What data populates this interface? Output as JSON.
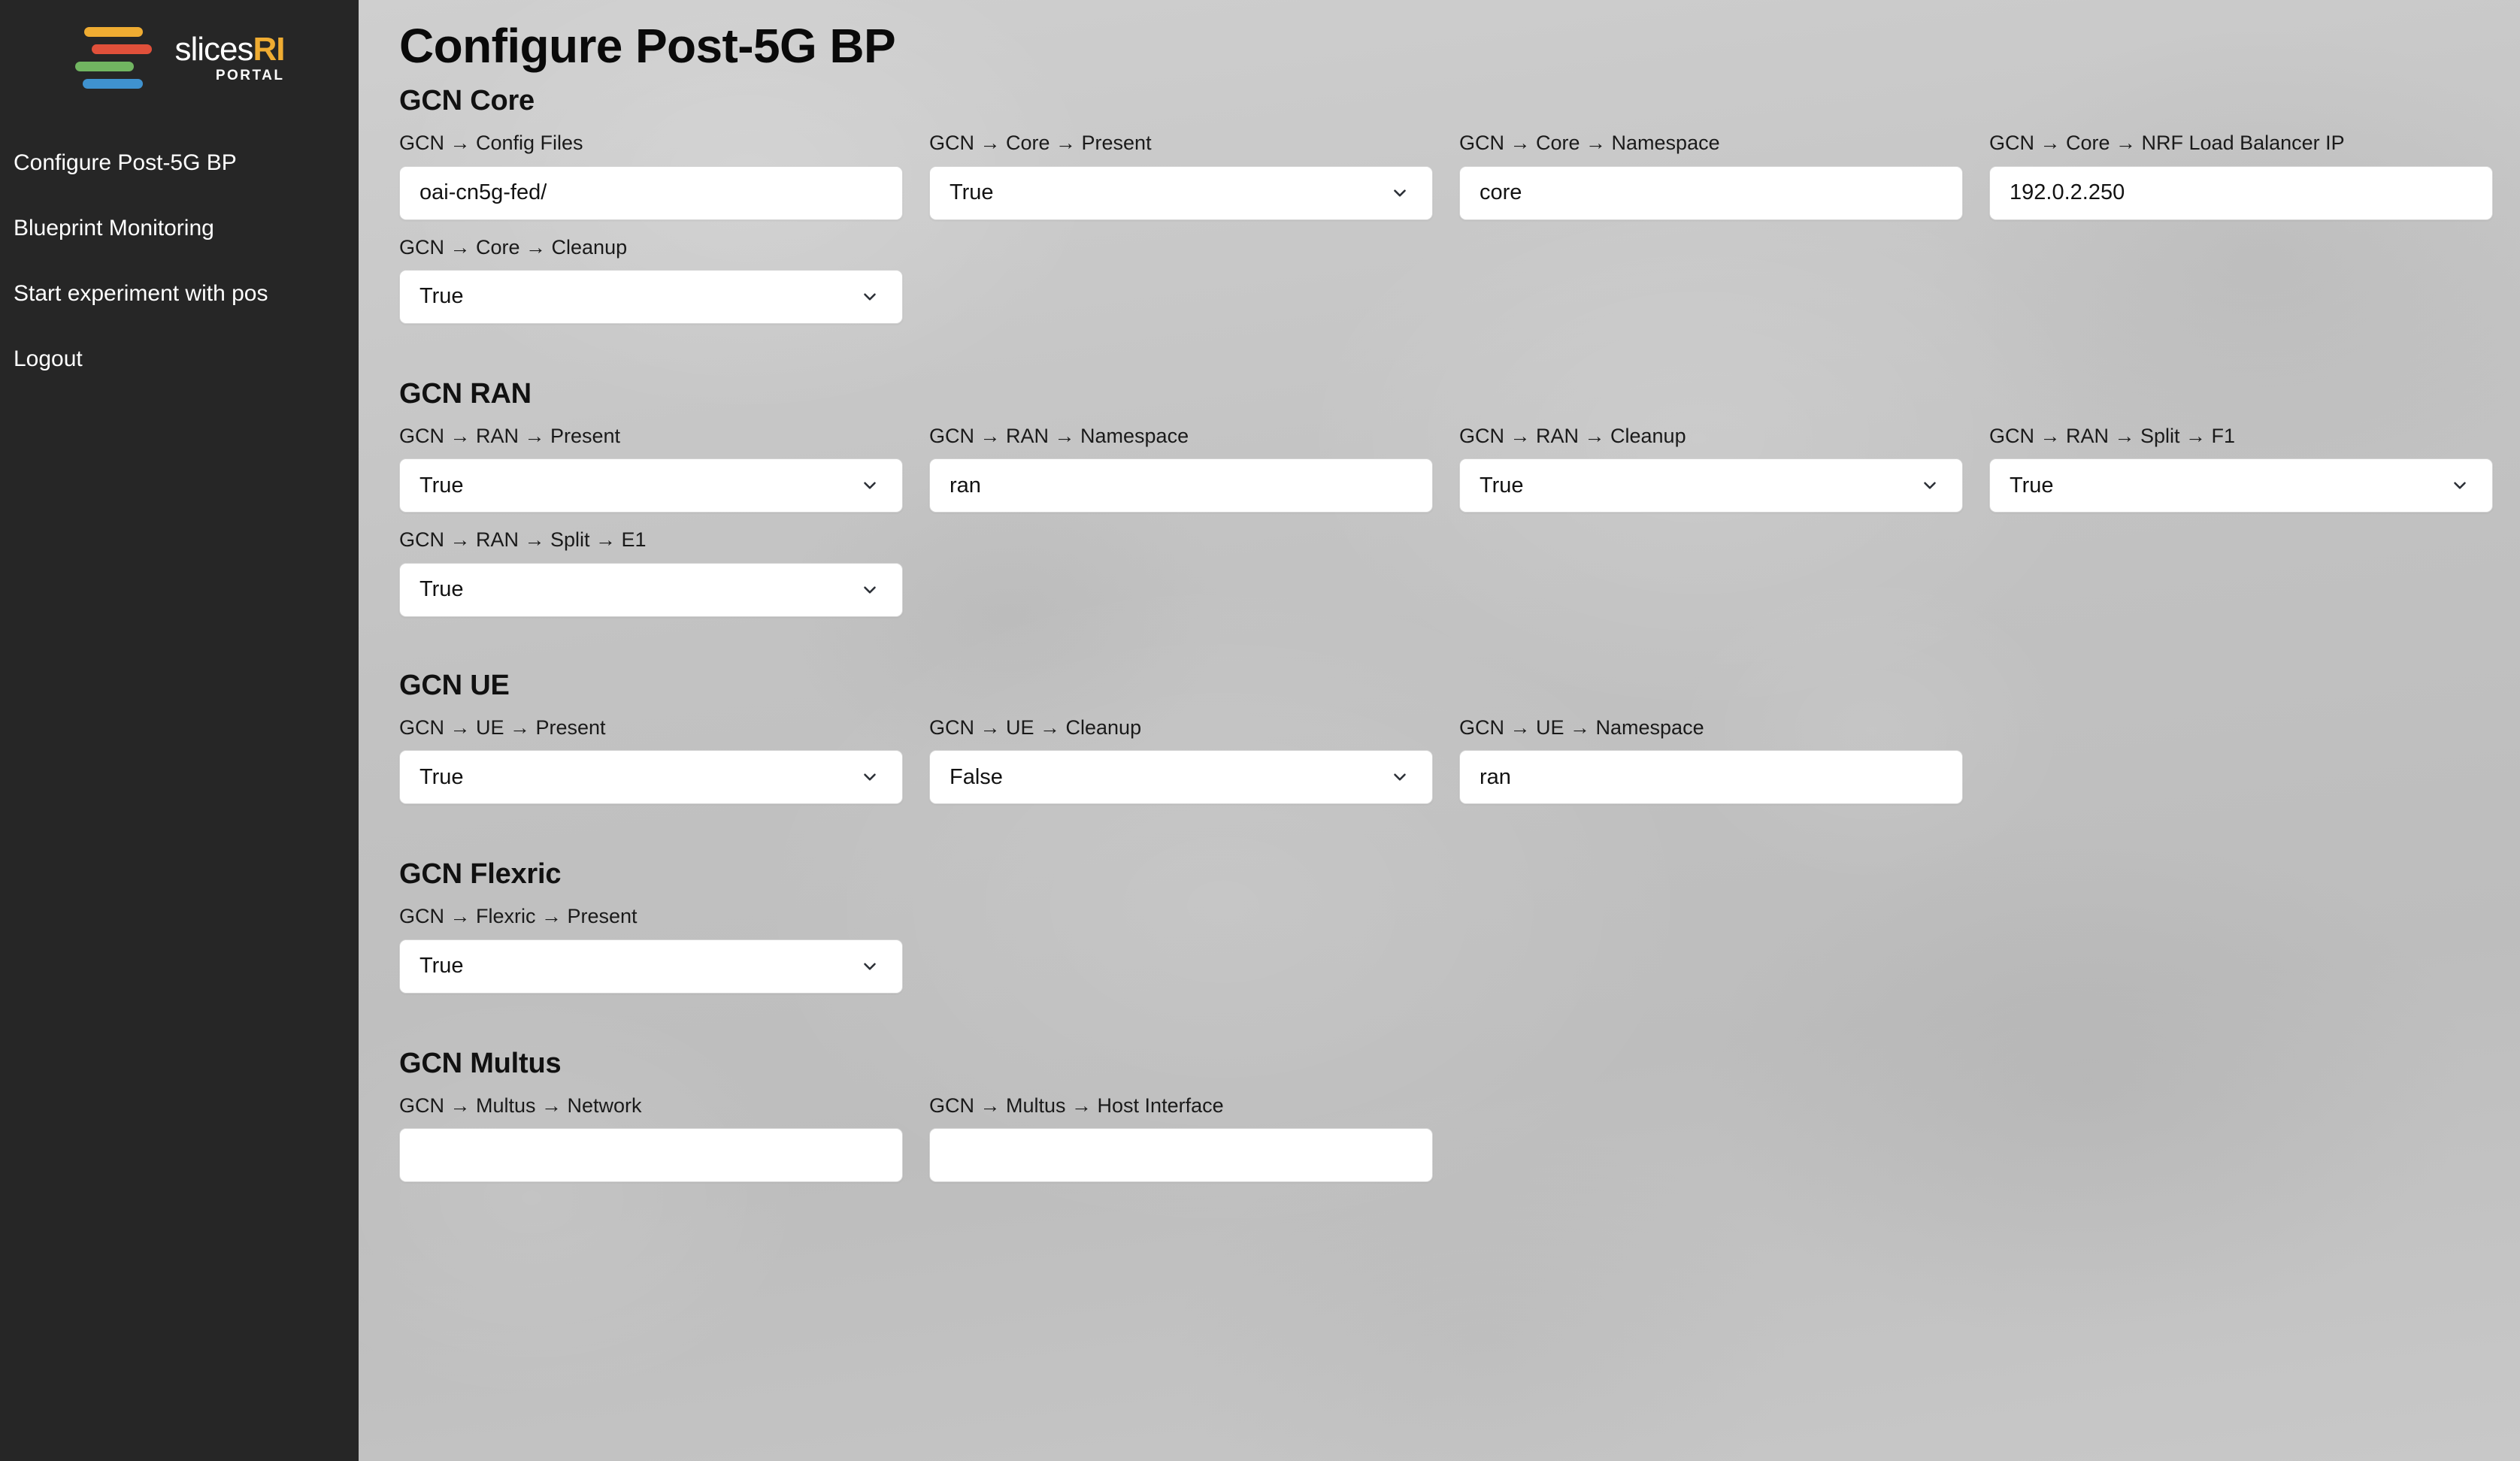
{
  "sidebar": {
    "logo": {
      "name_main": "slices",
      "name_accent": "RI",
      "subtitle": "PORTAL",
      "bar_colors": [
        "#efac32",
        "#e0503a",
        "#71b561",
        "#3f92cf"
      ]
    },
    "items": [
      {
        "label": "Configure Post-5G BP"
      },
      {
        "label": "Blueprint Monitoring"
      },
      {
        "label": "Start experiment with pos"
      },
      {
        "label": "Logout"
      }
    ]
  },
  "main": {
    "page_title": "Configure Post-5G BP",
    "sections": [
      {
        "id": "gcn-core",
        "title": "GCN Core",
        "fields": [
          {
            "label": "GCN → Config Files",
            "type": "text",
            "value": "oai-cn5g-fed/"
          },
          {
            "label": "GCN → Core → Present",
            "type": "select",
            "value": "True"
          },
          {
            "label": "GCN → Core → Namespace",
            "type": "text",
            "value": "core"
          },
          {
            "label": "GCN → Core → NRF Load Balancer IP",
            "type": "text",
            "value": "192.0.2.250"
          },
          {
            "label": "GCN → Core → Cleanup",
            "type": "select",
            "value": "True"
          }
        ]
      },
      {
        "id": "gcn-ran",
        "title": "GCN RAN",
        "fields": [
          {
            "label": "GCN → RAN → Present",
            "type": "select",
            "value": "True"
          },
          {
            "label": "GCN → RAN → Namespace",
            "type": "text",
            "value": "ran"
          },
          {
            "label": "GCN → RAN → Cleanup",
            "type": "select",
            "value": "True"
          },
          {
            "label": "GCN → RAN → Split → F1",
            "type": "select",
            "value": "True"
          },
          {
            "label": "GCN → RAN → Split → E1",
            "type": "select",
            "value": "True"
          }
        ]
      },
      {
        "id": "gcn-ue",
        "title": "GCN UE",
        "fields": [
          {
            "label": "GCN → UE → Present",
            "type": "select",
            "value": "True"
          },
          {
            "label": "GCN → UE → Cleanup",
            "type": "select",
            "value": "False"
          },
          {
            "label": "GCN → UE → Namespace",
            "type": "text",
            "value": "ran"
          }
        ]
      },
      {
        "id": "gcn-flexric",
        "title": "GCN Flexric",
        "fields": [
          {
            "label": "GCN → Flexric → Present",
            "type": "select",
            "value": "True"
          }
        ]
      },
      {
        "id": "gcn-multus",
        "title": "GCN Multus",
        "fields": [
          {
            "label": "GCN → Multus → Network",
            "type": "text",
            "value": ""
          },
          {
            "label": "GCN → Multus → Host Interface",
            "type": "text",
            "value": ""
          }
        ]
      }
    ]
  },
  "icons": {
    "chevron_down": "chevron-down-icon"
  },
  "colors": {
    "sidebar_bg": "#262626",
    "accent": "#efac32",
    "page_bg": "#c3c3c3",
    "control_bg": "#ffffff",
    "text_dark": "#111111",
    "text_light": "#ffffff"
  }
}
